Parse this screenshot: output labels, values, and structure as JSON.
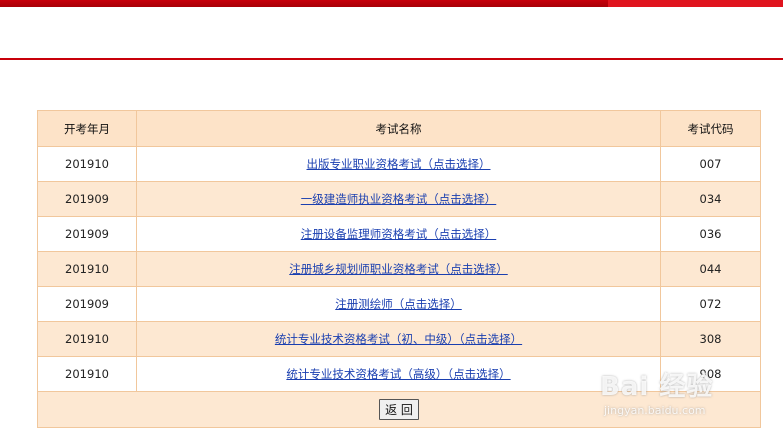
{
  "table": {
    "headers": [
      "开考年月",
      "考试名称",
      "考试代码"
    ],
    "rows": [
      {
        "date": "201910",
        "name": "出版专业职业资格考试（点击选择）",
        "code": "007"
      },
      {
        "date": "201909",
        "name": "一级建造师执业资格考试（点击选择）",
        "code": "034"
      },
      {
        "date": "201909",
        "name": "注册设备监理师资格考试（点击选择）",
        "code": "036"
      },
      {
        "date": "201910",
        "name": "注册城乡规划师职业资格考试（点击选择）",
        "code": "044"
      },
      {
        "date": "201909",
        "name": "注册测绘师（点击选择）",
        "code": "072"
      },
      {
        "date": "201910",
        "name": "统计专业技术资格考试（初、中级）（点击选择）",
        "code": "308"
      },
      {
        "date": "201910",
        "name": "统计专业技术资格考试（高级）（点击选择）",
        "code": "908"
      }
    ],
    "back_label": "返 回"
  },
  "watermark": {
    "main": "Bai 经验",
    "sub": "jingyan.baidu.com"
  },
  "colors": {
    "top_bar": "#c8000a",
    "header_bg": "#fde3c8",
    "row_alt_bg": "#fde8d2",
    "border": "#f1c79c",
    "link": "#1a3fb0"
  }
}
